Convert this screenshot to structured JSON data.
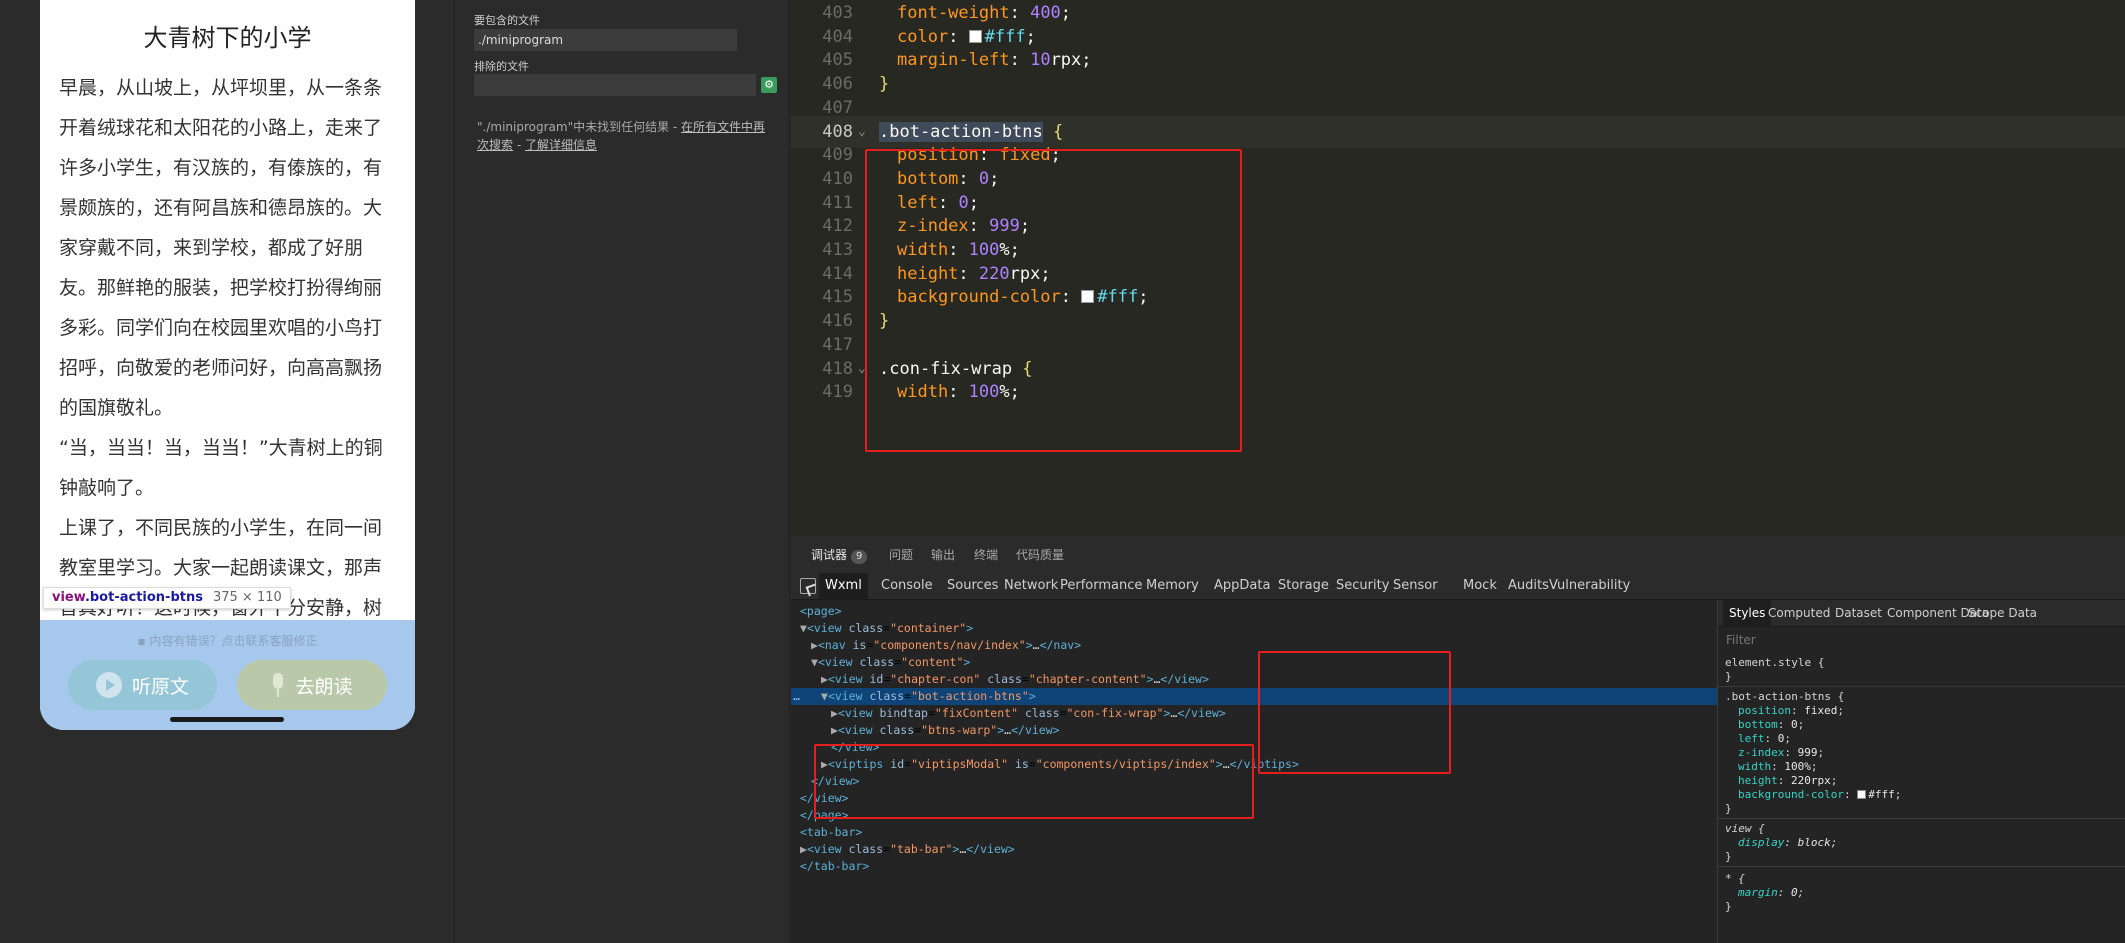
{
  "simulator": {
    "article_title": "大青树下的小学",
    "paragraphs": [
      "早晨，从山坡上，从坪坝里，从一条条开着绒球花和太阳花的小路上，走来了许多小学生，有汉族的，有傣族的，有景颇族的，还有阿昌族和德昂族的。大家穿戴不同，来到学校，都成了好朋友。那鲜艳的服装，把学校打扮得绚丽多彩。同学们向在校园里欢唱的小鸟打招呼，向敬爱的老师问好，向高高飘扬的国旗敬礼。",
      "“当，当当！当，当当！”大青树上的铜钟敲响了。",
      "上课了，不同民族的小学生，在同一间教室里学习。大家一起朗读课文，那声音真好听！这时候，窗外十分安静，树"
    ],
    "hover_tip": {
      "tag": "view",
      "class": ".bot-action-btns",
      "size": "375 × 110"
    },
    "report_text": "内容有错误？点击联系客服修正",
    "listen_label": "听原文",
    "read_label": "去朗读"
  },
  "search_panel": {
    "include_label": "要包含的文件",
    "include_value": "./miniprogram",
    "exclude_label": "排除的文件",
    "exclude_value": "",
    "msg_prefix": "\"./miniprogram\"中未找到任何结果 - ",
    "msg_link1": "在所有文件中再次搜索",
    "msg_sep": " - ",
    "msg_link2": "了解详细信息"
  },
  "editor": {
    "lines": [
      {
        "n": "403",
        "prop": "font-weight",
        "val": "400"
      },
      {
        "n": "404",
        "prop": "color",
        "color": "#fff"
      },
      {
        "n": "405",
        "prop": "margin-left",
        "val": "10",
        "unit": "rpx"
      },
      {
        "n": "406",
        "brace": "}"
      },
      {
        "n": "407"
      },
      {
        "n": "408",
        "selector": ".bot-action-btns",
        "open": " {"
      },
      {
        "n": "409",
        "prop": "position",
        "kw": "fixed"
      },
      {
        "n": "410",
        "prop": "bottom",
        "val": "0"
      },
      {
        "n": "411",
        "prop": "left",
        "val": "0"
      },
      {
        "n": "412",
        "prop": "z-index",
        "val": "999"
      },
      {
        "n": "413",
        "prop": "width",
        "val": "100",
        "unit": "%"
      },
      {
        "n": "414",
        "prop": "height",
        "val": "220",
        "unit": "rpx"
      },
      {
        "n": "415",
        "prop": "background-color",
        "color": "#fff"
      },
      {
        "n": "416",
        "brace": "}"
      },
      {
        "n": "417"
      },
      {
        "n": "418",
        "selector": ".con-fix-wrap",
        "open": " {"
      },
      {
        "n": "419",
        "prop": "width",
        "val": "100",
        "unit": "%"
      }
    ]
  },
  "devtools": {
    "top_tabs": [
      {
        "label": "调试器",
        "badge": "9"
      },
      {
        "label": "问题"
      },
      {
        "label": "输出"
      },
      {
        "label": "终端"
      },
      {
        "label": "代码质量"
      }
    ],
    "tabs": [
      "Wxml",
      "Console",
      "Sources",
      "Network",
      "Performance",
      "Memory",
      "AppData",
      "Storage",
      "Security",
      "Sensor",
      "Mock",
      "Audits",
      "Vulnerability"
    ],
    "active_tab": "Wxml",
    "tree": [
      "<page>",
      "▼<view class=\"container\">",
      "▶<nav is=\"components/nav/index\">…</nav>",
      "▼<view class=\"content\">",
      "▶<view id=\"chapter-con\" class=\"chapter-content\">…</view>",
      "▼<view class=\"bot-action-btns\">",
      "▶<view bindtap=\"fixContent\" class=\"con-fix-wrap\">…</view>",
      "▶<view class=\"btns-warp\">…</view>",
      "</view>",
      "▶<viptips id=\"viptipsModal\" is=\"components/viptips/index\">…</viptips>",
      "</view>",
      "</view>",
      "</page>",
      "<tab-bar>",
      "▶<view class=\"tab-bar\">…</view>",
      "</tab-bar>"
    ],
    "styles_tabs": [
      "Styles",
      "Computed",
      "Dataset",
      "Component Data",
      "Scope Data"
    ],
    "filter_placeholder": "Filter",
    "element_style": "element.style {",
    "element_style_close": "}",
    "rule_selector": ".bot-action-btns {",
    "rule_props": [
      {
        "p": "position",
        "v": "fixed"
      },
      {
        "p": "bottom",
        "v": "0"
      },
      {
        "p": "left",
        "v": "0"
      },
      {
        "p": "z-index",
        "v": "999"
      },
      {
        "p": "width",
        "v": "100%"
      },
      {
        "p": "height",
        "v": "220rpx"
      },
      {
        "p": "background-color",
        "v": "#fff"
      }
    ],
    "view_selector": "view {",
    "view_prop": {
      "p": "display",
      "v": "block"
    },
    "star_selector": "* {",
    "star_prop": {
      "p": "margin",
      "v": "0"
    },
    "close": "}"
  }
}
